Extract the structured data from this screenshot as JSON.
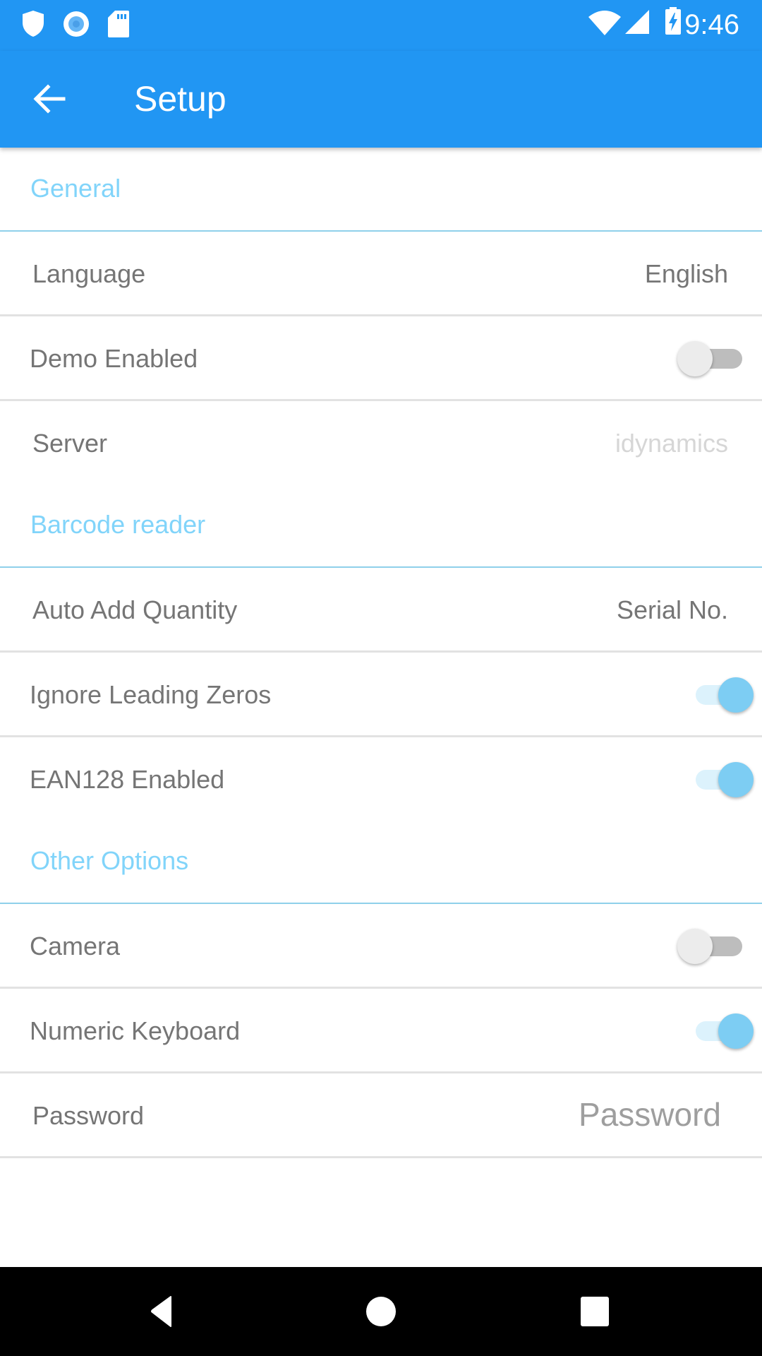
{
  "status_bar": {
    "time": "9:46",
    "left_icons": [
      "shield-icon",
      "circle-record-icon",
      "sd-card-icon"
    ],
    "right_icons": [
      "wifi-icon",
      "cell-signal-icon",
      "battery-charging-icon"
    ]
  },
  "app_bar": {
    "back_icon": "arrow-back-icon",
    "title": "Setup"
  },
  "sections": [
    {
      "header": "General",
      "rows": [
        {
          "label": "Language",
          "type": "value",
          "value": "English"
        },
        {
          "label": "Demo Enabled",
          "type": "toggle",
          "checked": false
        },
        {
          "label": "Server",
          "type": "hint",
          "value": "idynamics"
        }
      ]
    },
    {
      "header": "Barcode reader",
      "rows": [
        {
          "label": "Auto Add Quantity",
          "type": "value",
          "value": "Serial No."
        },
        {
          "label": "Ignore Leading Zeros",
          "type": "toggle",
          "checked": true
        },
        {
          "label": "EAN128 Enabled",
          "type": "toggle",
          "checked": true
        }
      ]
    },
    {
      "header": "Other Options",
      "rows": [
        {
          "label": "Camera",
          "type": "toggle",
          "checked": false
        },
        {
          "label": "Numeric Keyboard",
          "type": "toggle",
          "checked": true
        },
        {
          "label": "Password",
          "type": "input",
          "value": "",
          "placeholder": "Password"
        }
      ]
    }
  ],
  "nav_bar": {
    "buttons": [
      "back-triangle-icon",
      "home-circle-icon",
      "recents-square-icon"
    ]
  },
  "colors": {
    "primary": "#2196F3",
    "section_header": "#81D4FA",
    "toggle_on_thumb": "#7DCDF3",
    "toggle_off_thumb": "#ECECEC"
  }
}
